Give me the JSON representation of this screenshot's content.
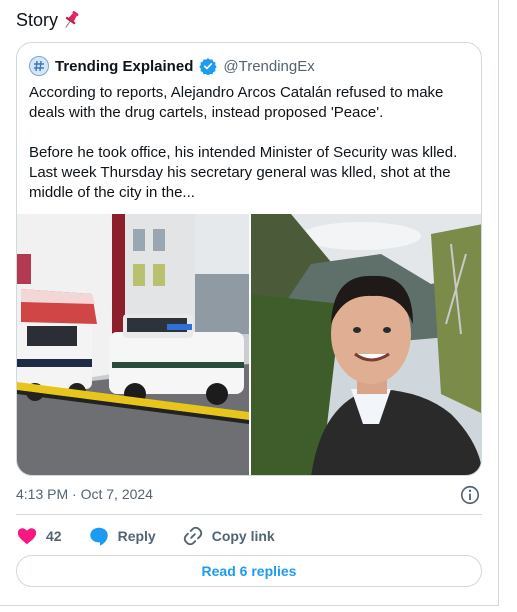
{
  "story": {
    "title": "Story"
  },
  "quoted_post": {
    "author_name": "Trending Explained",
    "author_handle": "@TrendingEx",
    "text_paragraphs": [
      [
        "According to reports, Alejandro Arcos Catalán refused to make",
        "deals with the drug cartels, instead proposed 'Peace'."
      ],
      [
        "Before he took office, his intended Minister of Security was klled.",
        "Last week Thursday his secretary general was klled, shot at the",
        "middle of the city in the..."
      ]
    ],
    "media": [
      {
        "icon": "police-scene-photo"
      },
      {
        "icon": "man-selfie-photo"
      }
    ]
  },
  "post": {
    "timestamp": "4:13 PM · Oct 7, 2024"
  },
  "actions": {
    "like_count": "42",
    "reply_label": "Reply",
    "copy_link_label": "Copy link"
  },
  "read_replies": {
    "label": "Read 6 replies"
  },
  "colors": {
    "accent": "#1d9bf0",
    "like": "#f91880",
    "border": "#cfd9de",
    "muted": "#536471"
  }
}
